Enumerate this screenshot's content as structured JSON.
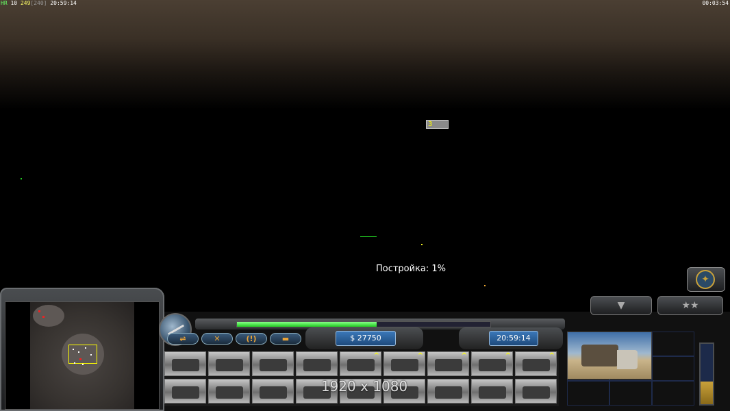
{
  "hud": {
    "tag": "HR",
    "fps": "10",
    "units": "249",
    "limit": "[240]",
    "clock": "20:59:14",
    "elapsed": "00:03:54"
  },
  "world": {
    "group_number": "3",
    "construction_progress": "Постройка: 1%"
  },
  "command_bar": {
    "buttons": [
      {
        "name": "ladder-icon",
        "glyph": "⇌"
      },
      {
        "name": "repair-icon",
        "glyph": "✕"
      },
      {
        "name": "alert-icon",
        "glyph": "(!)"
      },
      {
        "name": "chat-icon",
        "glyph": "▬"
      }
    ],
    "money": "$ 27750",
    "game_time": "20:59:14",
    "power_fraction": 0.55
  },
  "build_slots": [
    {
      "name": "build-slot-1",
      "upgrade": false
    },
    {
      "name": "build-slot-2",
      "upgrade": false
    },
    {
      "name": "build-slot-3",
      "upgrade": false
    },
    {
      "name": "build-slot-4",
      "upgrade": false
    },
    {
      "name": "build-slot-5",
      "upgrade": true
    },
    {
      "name": "build-slot-6",
      "upgrade": true
    },
    {
      "name": "build-slot-7",
      "upgrade": true
    },
    {
      "name": "build-slot-8",
      "upgrade": true
    },
    {
      "name": "build-slot-9",
      "upgrade": true
    },
    {
      "name": "build-slot-10",
      "upgrade": false
    },
    {
      "name": "build-slot-11",
      "upgrade": false
    },
    {
      "name": "build-slot-12",
      "upgrade": false
    },
    {
      "name": "build-slot-13",
      "upgrade": false
    },
    {
      "name": "build-slot-14",
      "upgrade": false
    },
    {
      "name": "build-slot-15",
      "upgrade": false
    },
    {
      "name": "build-slot-16",
      "upgrade": false
    },
    {
      "name": "build-slot-17",
      "upgrade": false
    },
    {
      "name": "build-slot-18",
      "upgrade": false
    }
  ],
  "resolution_overlay": "1920 x 1080",
  "gauge_fraction": 0.38,
  "colors": {
    "accent_gold": "#c9a13a",
    "power_green": "#2c2",
    "display_blue": "#2a5f98"
  }
}
